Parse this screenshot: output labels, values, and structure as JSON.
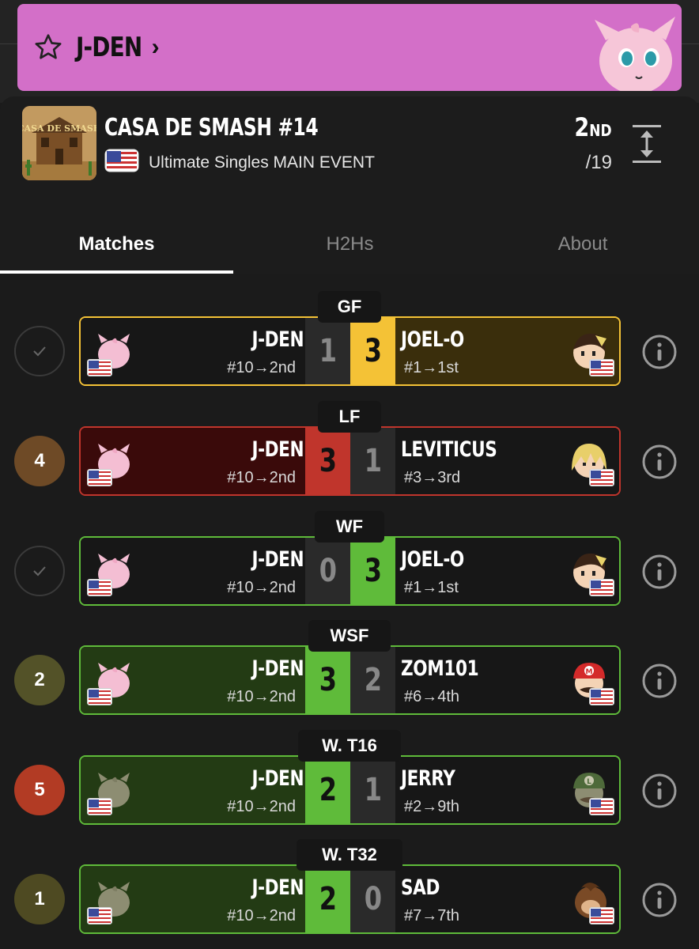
{
  "player": {
    "name": "J-DEN"
  },
  "event": {
    "title": "CASA DE SMASH #14",
    "subtitle": "Ultimate Singles MAIN EVENT",
    "placing": "2",
    "placing_suffix": "ND",
    "entrants": "/19",
    "logo_text": "CASA DE SMASH"
  },
  "tabs": [
    {
      "label": "Matches",
      "active": true
    },
    {
      "label": "H2Hs",
      "active": false
    },
    {
      "label": "About",
      "active": false
    }
  ],
  "matches": [
    {
      "round": "GF",
      "status": "check",
      "left": {
        "name": "J-DEN",
        "seed": "#10→2nd",
        "score": "1"
      },
      "right": {
        "name": "JOEL-O",
        "seed": "#1→1st",
        "score": "3"
      },
      "winner": "right",
      "style": "gold"
    },
    {
      "round": "LF",
      "status": "4",
      "left": {
        "name": "J-DEN",
        "seed": "#10→2nd",
        "score": "3"
      },
      "right": {
        "name": "LEVITICUS",
        "seed": "#3→3rd",
        "score": "1"
      },
      "winner": "left",
      "style": "red"
    },
    {
      "round": "WF",
      "status": "check",
      "left": {
        "name": "J-DEN",
        "seed": "#10→2nd",
        "score": "0"
      },
      "right": {
        "name": "JOEL-O",
        "seed": "#1→1st",
        "score": "3"
      },
      "winner": "right",
      "style": "green-right"
    },
    {
      "round": "WSF",
      "status": "2",
      "left": {
        "name": "J-DEN",
        "seed": "#10→2nd",
        "score": "3"
      },
      "right": {
        "name": "ZOM101",
        "seed": "#6→4th",
        "score": "2"
      },
      "winner": "left",
      "style": "green-left"
    },
    {
      "round": "W. T16",
      "status": "5",
      "left": {
        "name": "J-DEN",
        "seed": "#10→2nd",
        "score": "2"
      },
      "right": {
        "name": "JERRY",
        "seed": "#2→9th",
        "score": "1"
      },
      "winner": "left",
      "style": "green-left"
    },
    {
      "round": "W. T32",
      "status": "1",
      "left": {
        "name": "J-DEN",
        "seed": "#10→2nd",
        "score": "2"
      },
      "right": {
        "name": "SAD",
        "seed": "#7→7th",
        "score": "0"
      },
      "winner": "left",
      "style": "green-left"
    }
  ],
  "colors": {
    "pink": "#d36fc8",
    "gold": "#f4c236",
    "red": "#c0352c",
    "green": "#5fbb3a",
    "circle_4": "#6e4a26",
    "circle_2": "#535228",
    "circle_5": "#b23b24",
    "circle_1": "#4e4a22"
  }
}
